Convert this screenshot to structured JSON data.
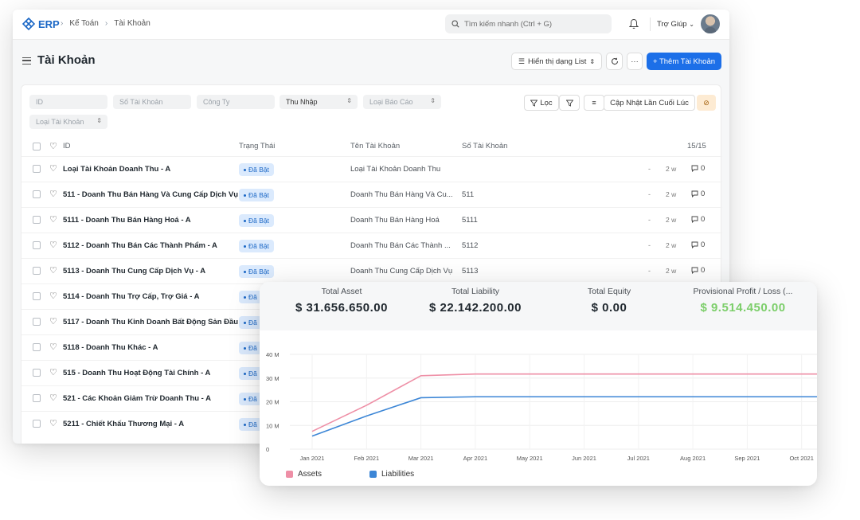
{
  "app": {
    "logo_text": "ERP",
    "breadcrumb": [
      "Kế Toán",
      "Tài Khoản"
    ],
    "search_placeholder": "Tìm kiếm nhanh (Ctrl + G)",
    "help_label": "Trợ Giúp"
  },
  "page": {
    "title": "Tài Khoản",
    "view_label": "Hiển thị dạng List",
    "more_label": "···",
    "new_label": "+ Thêm Tài Khoản"
  },
  "filters": {
    "id": "ID",
    "account_number": "Số Tài Khoản",
    "company": "Công Ty",
    "root_type": "Thu Nhập",
    "report_type": "Loại Báo Cáo",
    "account_type": "Loại Tài Khoản",
    "filter_label": "Lọc",
    "sort_label": "Cập Nhật Lần Cuối Lúc"
  },
  "table": {
    "columns": {
      "id": "ID",
      "status": "Trạng Thái",
      "account_name": "Tên Tài Khoản",
      "account_number": "Số Tài Khoản",
      "count": "15/15"
    },
    "rows": [
      {
        "id": "Loại Tài Khoản Doanh Thu - A",
        "status": "Đã Bật",
        "name": "Loại Tài Khoản Doanh Thu",
        "number": "",
        "modified": "-",
        "ago": "2 w",
        "comments": "0"
      },
      {
        "id": "511 - Doanh Thu Bán Hàng Và Cung Cấp Dịch Vụ",
        "status": "Đã Bật",
        "name": "Doanh Thu Bán Hàng Và Cu...",
        "number": "511",
        "modified": "-",
        "ago": "2 w",
        "comments": "0"
      },
      {
        "id": "5111 - Doanh Thu Bán Hàng Hoá - A",
        "status": "Đã Bật",
        "name": "Doanh Thu Bán Hàng Hoá",
        "number": "5111",
        "modified": "-",
        "ago": "2 w",
        "comments": "0"
      },
      {
        "id": "5112 - Doanh Thu Bán Các Thành Phẩm - A",
        "status": "Đã Bật",
        "name": "Doanh Thu Bán Các Thành ...",
        "number": "5112",
        "modified": "-",
        "ago": "2 w",
        "comments": "0"
      },
      {
        "id": "5113 - Doanh Thu Cung Cấp Dịch Vụ - A",
        "status": "Đã Bật",
        "name": "Doanh Thu Cung Cấp Dịch Vụ",
        "number": "5113",
        "modified": "-",
        "ago": "2 w",
        "comments": "0"
      },
      {
        "id": "5114 - Doanh Thu Trợ Cấp, Trợ Giá - A",
        "status": "Đã",
        "name": "",
        "number": "",
        "modified": "",
        "ago": "",
        "comments": ""
      },
      {
        "id": "5117 - Doanh Thu Kinh Doanh Bất Động Sản Đầu",
        "status": "Đã",
        "name": "",
        "number": "",
        "modified": "",
        "ago": "",
        "comments": ""
      },
      {
        "id": "5118 - Doanh Thu Khác - A",
        "status": "Đã",
        "name": "",
        "number": "",
        "modified": "",
        "ago": "",
        "comments": ""
      },
      {
        "id": "515 - Doanh Thu Hoạt Động Tài Chính - A",
        "status": "Đã",
        "name": "",
        "number": "",
        "modified": "",
        "ago": "",
        "comments": ""
      },
      {
        "id": "521 - Các Khoản Giảm Trừ Doanh Thu - A",
        "status": "Đã",
        "name": "",
        "number": "",
        "modified": "",
        "ago": "",
        "comments": ""
      },
      {
        "id": "5211 - Chiết Khấu Thương Mại - A",
        "status": "Đã",
        "name": "",
        "number": "",
        "modified": "",
        "ago": "",
        "comments": ""
      }
    ]
  },
  "dashboard": {
    "kpis": [
      {
        "label": "Total Asset",
        "value": "$ 31.656.650.00",
        "color": "#1f272e"
      },
      {
        "label": "Total Liability",
        "value": "$ 22.142.200.00",
        "color": "#1f272e"
      },
      {
        "label": "Total Equity",
        "value": "$ 0.00",
        "color": "#1f272e"
      },
      {
        "label": "Provisional Profit / Loss (...",
        "value": "$ 9.514.450.00",
        "color": "#7cce6a"
      }
    ]
  },
  "chart_data": {
    "type": "line",
    "x": [
      "Jan 2021",
      "Feb 2021",
      "Mar 2021",
      "Apr 2021",
      "May 2021",
      "Jun 2021",
      "Jul 2021",
      "Aug 2021",
      "Sep 2021",
      "Oct 2021"
    ],
    "series": [
      {
        "name": "Assets",
        "color": "#ee8fa6",
        "values": [
          7.5,
          18.5,
          31,
          31.7,
          31.7,
          31.7,
          31.7,
          31.7,
          31.7,
          31.7
        ]
      },
      {
        "name": "Liabilities",
        "color": "#3c86d6",
        "values": [
          5.5,
          14,
          21.7,
          22.1,
          22.1,
          22.1,
          22.1,
          22.1,
          22.1,
          22.1
        ]
      }
    ],
    "y_ticks": [
      "0",
      "10 M",
      "20 M",
      "30 M",
      "40 M"
    ],
    "ylim": [
      0,
      40
    ],
    "grid": true,
    "legend": "bottom-left",
    "title": "",
    "xlabel": "",
    "ylabel": ""
  }
}
